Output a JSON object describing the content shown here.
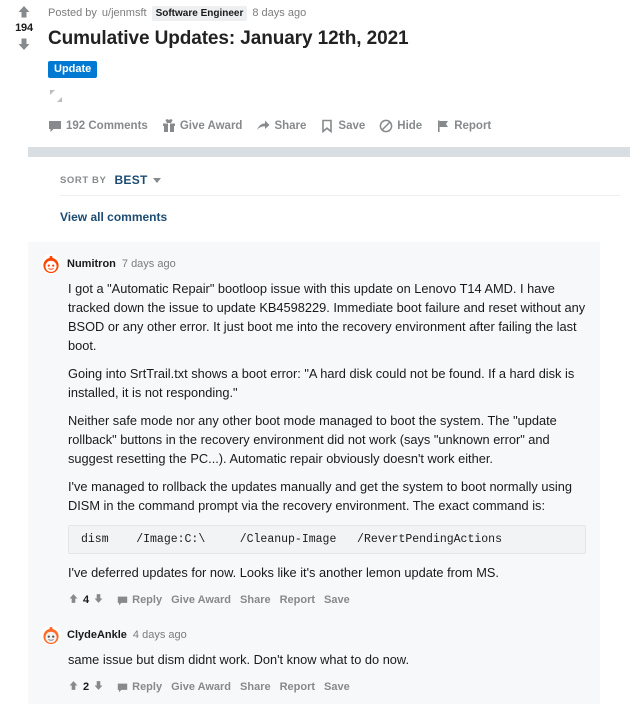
{
  "post": {
    "vote_count": "194",
    "upvote_icon": "upvote-arrow-icon",
    "downvote_icon": "downvote-arrow-icon",
    "posted_by_prefix": "Posted by",
    "author": "u/jenmsft",
    "user_flair": "Software Engineer",
    "age": "8 days ago",
    "title": "Cumulative Updates: January 12th, 2021",
    "flair": "Update",
    "flair_color": "#0079d3",
    "expand_icon": "expand-diagonal-icon",
    "actions": [
      {
        "label": "192 Comments",
        "icon": "comment-bubble-icon"
      },
      {
        "label": "Give Award",
        "icon": "gift-icon"
      },
      {
        "label": "Share",
        "icon": "share-arrow-icon"
      },
      {
        "label": "Save",
        "icon": "bookmark-icon"
      },
      {
        "label": "Hide",
        "icon": "hide-circle-icon"
      },
      {
        "label": "Report",
        "icon": "flag-icon"
      }
    ]
  },
  "sort": {
    "label": "SORT BY",
    "value": "BEST",
    "caret_icon": "chevron-down-icon"
  },
  "view_all_comments": "View all comments",
  "comments": [
    {
      "avatar_icon": "reddit-snoo-avatar-red",
      "author": "Numitron",
      "age": "7 days ago",
      "paragraphs": [
        "I got a \"Automatic Repair\" bootloop issue with this update on Lenovo T14 AMD. I have tracked down the issue to update KB4598229. Immediate boot failure and reset without any BSOD or any other error. It just boot me into the recovery environment after failing the last boot.",
        "Going into SrtTrail.txt shows a boot error: \"A hard disk could not be found. If a hard disk is installed, it is not responding.\"",
        "Neither safe mode nor any other boot mode managed to boot the system. The \"update rollback\" buttons in the recovery environment did not work (says \"unknown error\" and suggest resetting the PC...). Automatic repair obviously doesn't work either.",
        "I've managed to rollback the updates manually and get the system to boot normally using DISM in the command prompt via the recovery environment. The exact command is:"
      ],
      "code": "dism    /Image:C:\\     /Cleanup-Image   /RevertPendingActions",
      "closing_paragraph": "I've deferred updates for now. Looks like it's another lemon update from MS.",
      "vote_count": "4",
      "actions": [
        "Reply",
        "Give Award",
        "Share",
        "Report",
        "Save"
      ]
    },
    {
      "avatar_icon": "reddit-snoo-avatar-orange",
      "author": "ClydeAnkle",
      "age": "4 days ago",
      "paragraphs": [
        "same issue but dism didnt work. Don't know what to do now."
      ],
      "vote_count": "2",
      "actions": [
        "Reply",
        "Give Award",
        "Share",
        "Report",
        "Save"
      ]
    }
  ]
}
